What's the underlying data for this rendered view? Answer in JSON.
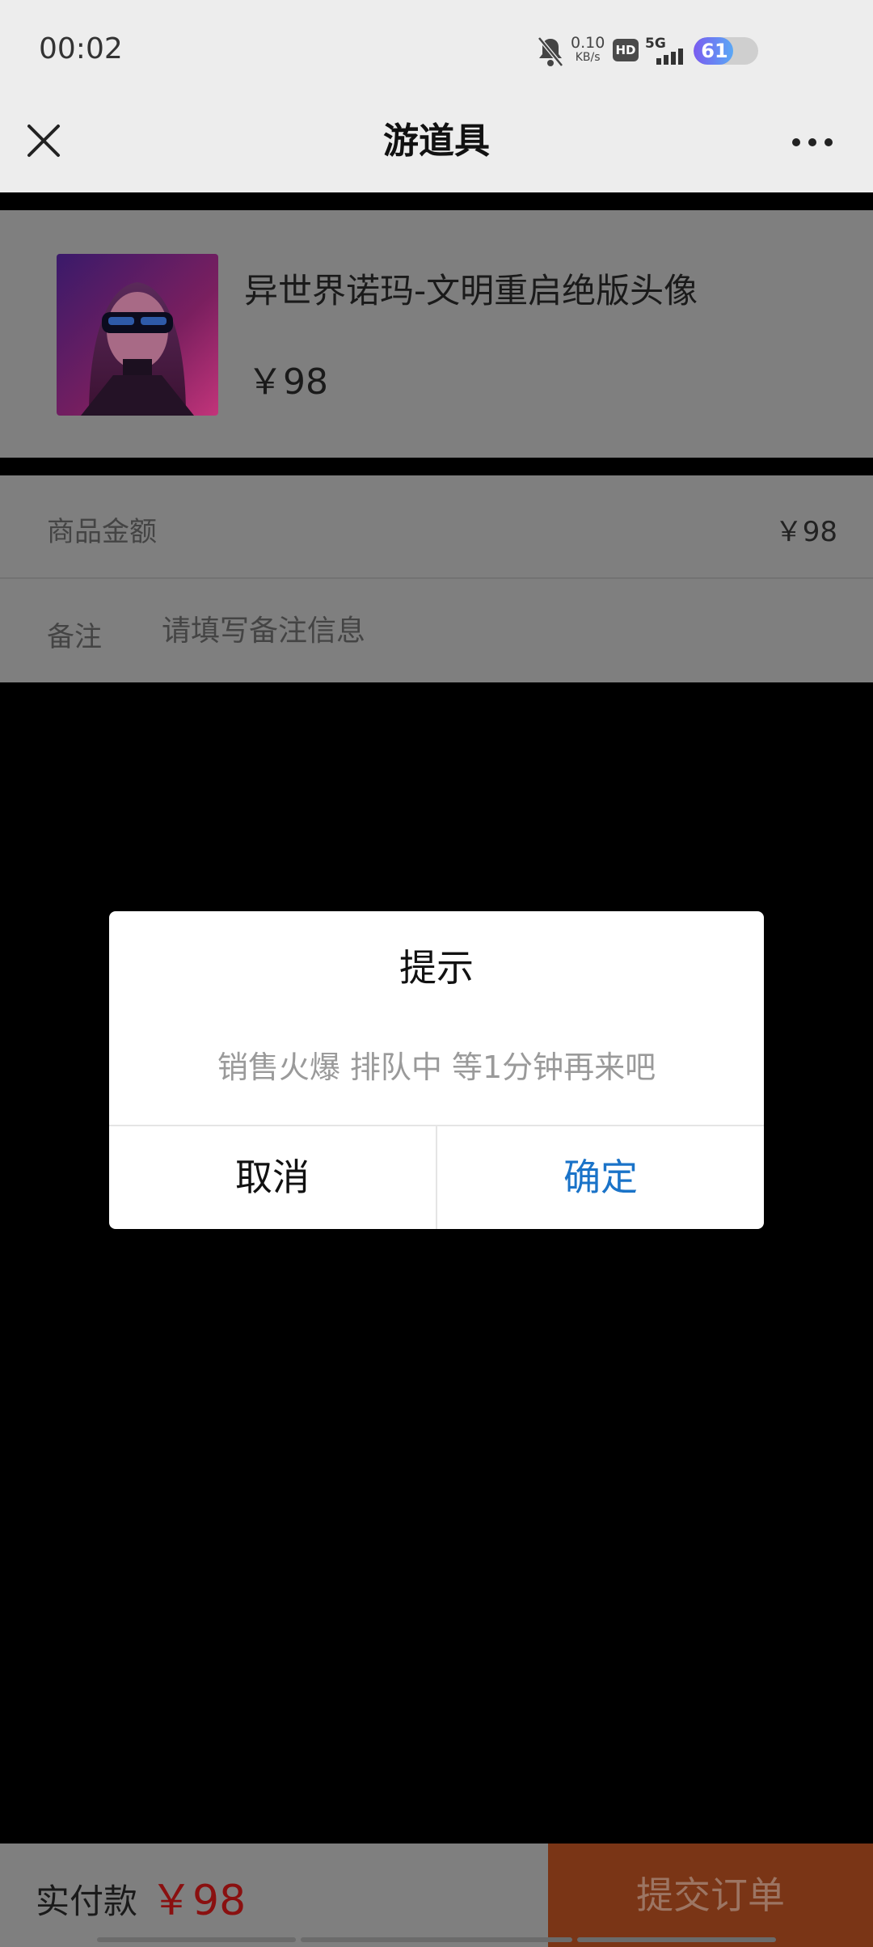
{
  "status_bar": {
    "time": "00:02",
    "net_speed_value": "0.10",
    "net_speed_unit": "KB/s",
    "hd_label": "HD",
    "network_type": "5G",
    "battery_level": "61",
    "battery_fraction": 0.61
  },
  "nav": {
    "title": "游道具",
    "close_icon": "close-icon",
    "more_icon": "more-icon"
  },
  "product": {
    "name": "异世界诺玛-文明重启绝版头像",
    "price": "￥98"
  },
  "details": {
    "amount_label": "商品金额",
    "amount_value": "￥98",
    "note_label": "备注",
    "note_placeholder": "请填写备注信息"
  },
  "footer": {
    "pay_label": "实付款",
    "pay_amount": "￥98",
    "submit_label": "提交订单"
  },
  "dialog": {
    "title": "提示",
    "message": "销售火爆 排队中 等1分钟再来吧",
    "cancel_label": "取消",
    "confirm_label": "确定"
  },
  "colors": {
    "confirm_blue": "#1a73c8",
    "price_red": "#8a1010",
    "submit_orange": "#7a3516"
  }
}
